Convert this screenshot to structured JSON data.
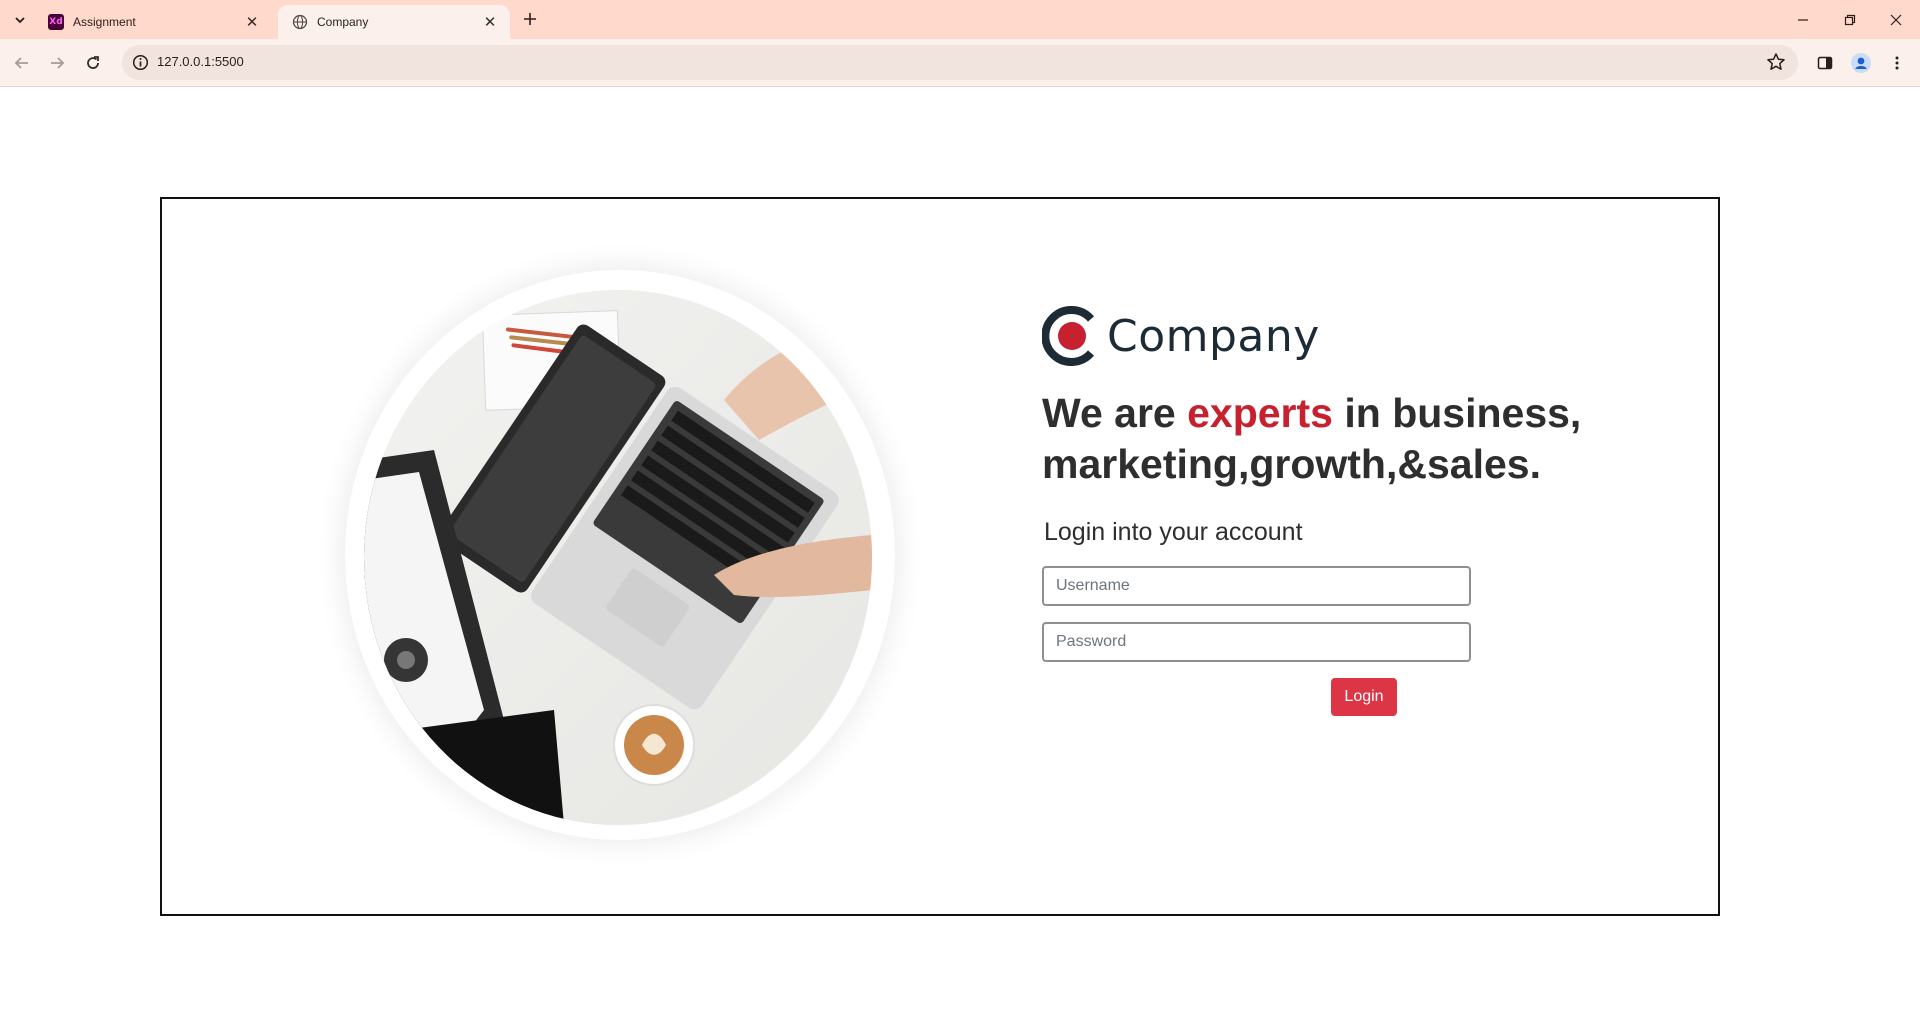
{
  "browser": {
    "tabs": [
      {
        "title": "Assignment",
        "favicon": "adobe-xd-icon",
        "favicon_text": "Xd",
        "active": false
      },
      {
        "title": "Company",
        "favicon": "globe-icon",
        "active": true
      }
    ],
    "url": "127.0.0.1:5500"
  },
  "page": {
    "brand": {
      "name": "Company",
      "logo": "company-logo-icon"
    },
    "headline": {
      "before": "We are ",
      "accent": "experts",
      "after": " in business, marketing,growth,&sales."
    },
    "login": {
      "title": "Login into your account",
      "username_placeholder": "Username",
      "password_placeholder": "Password",
      "button_label": "Login"
    },
    "colors": {
      "accent": "#c7202f",
      "button": "#dc3545",
      "brand_dark": "#1c2b36",
      "tabstrip": "#ffd9cc"
    }
  }
}
